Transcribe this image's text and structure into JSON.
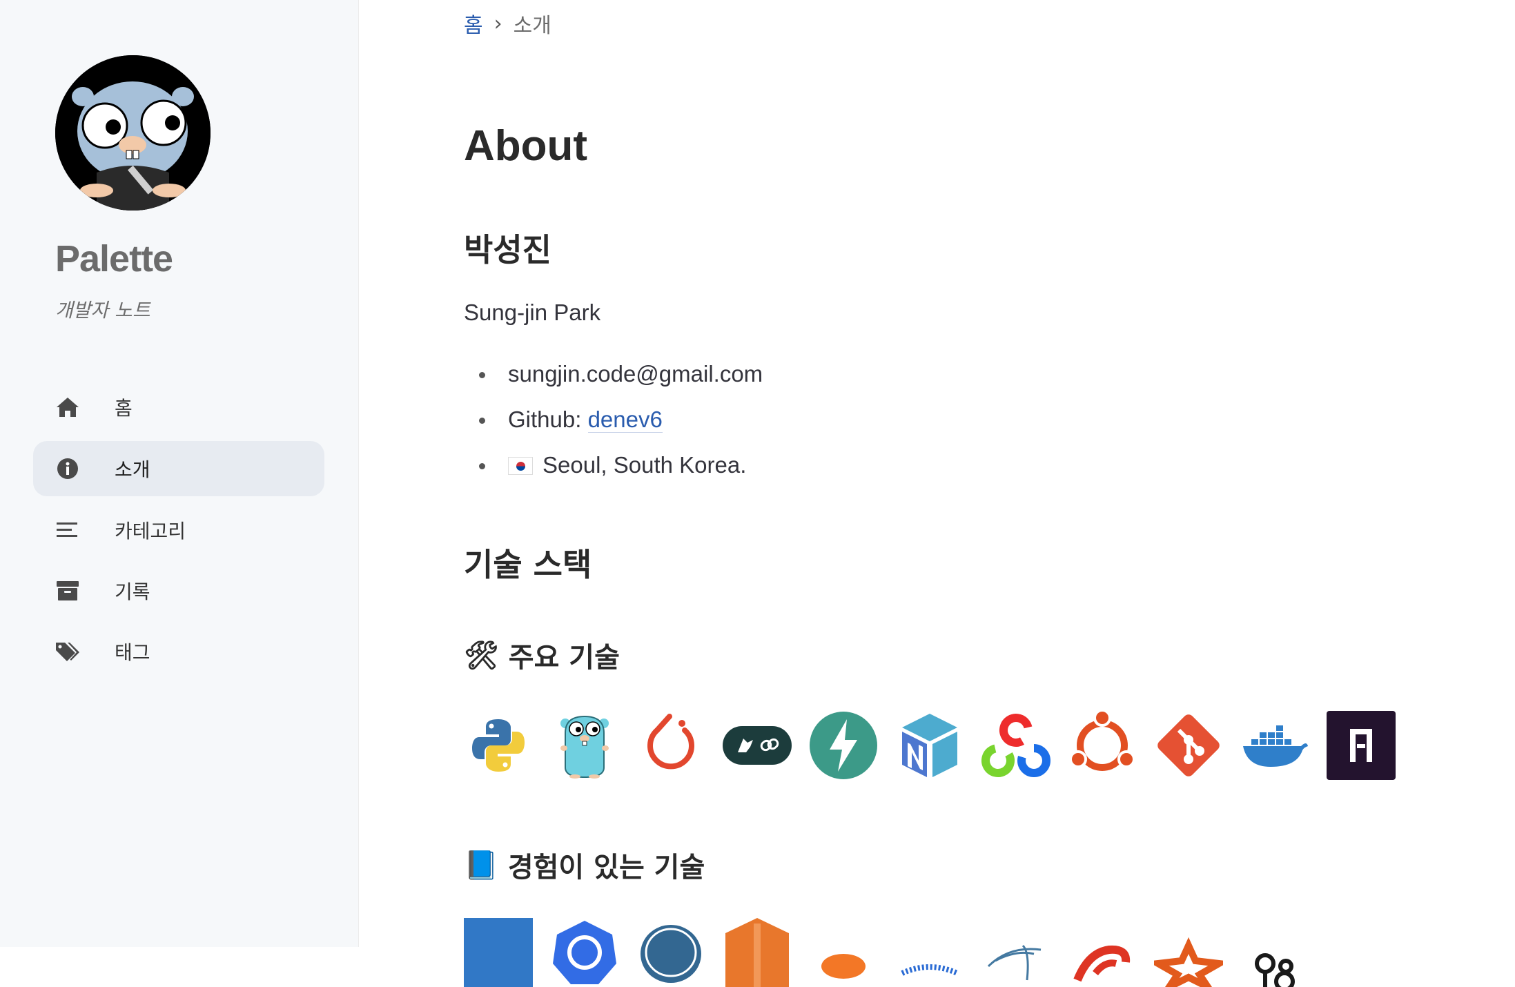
{
  "sidebar": {
    "site_title": "Palette",
    "site_subtitle": "개발자 노트",
    "nav": [
      {
        "label": "홈",
        "icon": "home-icon",
        "active": false
      },
      {
        "label": "소개",
        "icon": "info-icon",
        "active": true
      },
      {
        "label": "카테고리",
        "icon": "menu-icon",
        "active": false
      },
      {
        "label": "기록",
        "icon": "archive-icon",
        "active": false
      },
      {
        "label": "태그",
        "icon": "tags-icon",
        "active": false
      }
    ]
  },
  "breadcrumb": {
    "home": "홈",
    "separator": "›",
    "current": "소개"
  },
  "main": {
    "title": "About",
    "name_heading": "박성진",
    "english_name": "Sung-jin Park",
    "contacts": {
      "email": "sungjin.code@gmail.com",
      "github_prefix": "Github: ",
      "github_link": "denev6",
      "location": "Seoul, South Korea."
    },
    "tech_stack_heading": "기술 스택",
    "main_tech_heading": "주요 기술",
    "main_tech_emoji": "🛠",
    "main_tech_icons": [
      "python-icon",
      "go-gopher-icon",
      "pytorch-icon",
      "langchain-icon",
      "fastapi-icon",
      "numpy-icon",
      "opencv-icon",
      "ubuntu-icon",
      "git-icon",
      "docker-icon",
      "arxiv-icon"
    ],
    "experienced_heading": "경험이 있는 기술",
    "experienced_emoji": "📘",
    "experienced_icons": [
      "typescript-icon",
      "kubernetes-icon",
      "postgresql-icon",
      "html5-icon",
      "jupyter-icon",
      "uvicorn-icon",
      "mysql-icon",
      "scala-icon",
      "spark-icon",
      "mlflow-icon"
    ]
  },
  "colors": {
    "link": "#2a5cae",
    "sidebar_bg": "#f6f8fa",
    "active_nav_bg": "#e7ebf1"
  }
}
